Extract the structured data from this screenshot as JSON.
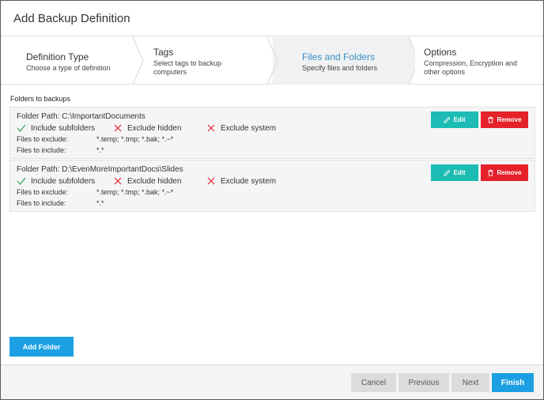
{
  "dialog": {
    "title": "Add Backup Definition"
  },
  "wizard": {
    "steps": [
      {
        "title": "Definition Type",
        "desc": "Choose a type of definition"
      },
      {
        "title": "Tags",
        "desc": "Select tags to backup computers"
      },
      {
        "title": "Files and Folders",
        "desc": "Specify files and folders"
      },
      {
        "title": "Options",
        "desc": "Compression, Encryption and other options"
      }
    ],
    "active_step": "Files and Folders",
    "active_color": "#3a8ec4"
  },
  "section_label": "Folders to backups",
  "folders": [
    {
      "path": "Folder Path: C:\\ImportantDocuments",
      "include_subfolders": {
        "label": "Include subfolders",
        "state": "checked",
        "icon": "check-icon"
      },
      "exclude_hidden": {
        "label": "Exclude hidden",
        "state": "unchecked",
        "icon": "x-icon"
      },
      "exclude_system": {
        "label": "Exclude system",
        "state": "unchecked",
        "icon": "x-icon"
      },
      "exclude_label": "Files to exclude:",
      "exclude_value": "*.temp; *.tmp; *.bak; *.~*",
      "include_label": "Files to include:",
      "include_value": "*.*",
      "edit_label": "Edit",
      "remove_label": "Remove"
    },
    {
      "path": "Folder Path: D:\\EvenMoreImportantDocs\\Slides",
      "include_subfolders": {
        "label": "Include subfolders",
        "state": "checked",
        "icon": "check-icon"
      },
      "exclude_hidden": {
        "label": "Exclude hidden",
        "state": "unchecked",
        "icon": "x-icon"
      },
      "exclude_system": {
        "label": "Exclude system",
        "state": "unchecked",
        "icon": "x-icon"
      },
      "exclude_label": "Files to exclude:",
      "exclude_value": "*.temp; *.tmp; *.bak; *.~*",
      "include_label": "Files to include:",
      "include_value": "*.*",
      "edit_label": "Edit",
      "remove_label": "Remove"
    }
  ],
  "add_folder_label": "Add Folder",
  "footer": {
    "cancel": "Cancel",
    "previous": "Previous",
    "next": "Next",
    "finish": "Finish"
  },
  "colors": {
    "edit_button": "#1cbcb4",
    "remove_button": "#e5212a",
    "primary_button": "#1ca0e3",
    "check": "#3aa655",
    "cross": "#e5212a"
  }
}
